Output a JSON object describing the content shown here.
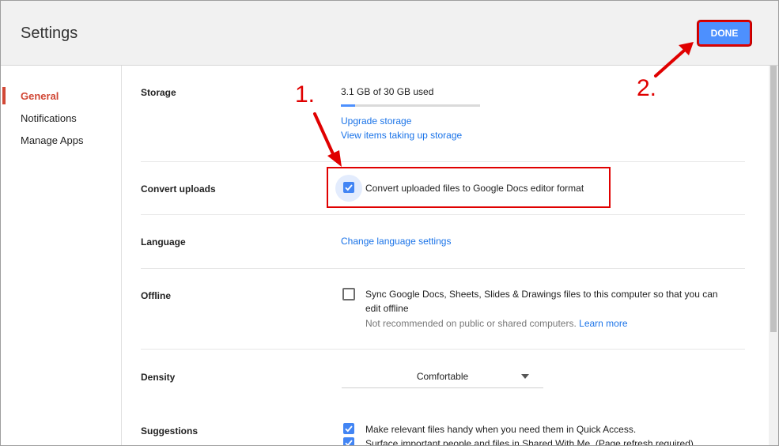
{
  "header": {
    "title": "Settings",
    "done_label": "DONE"
  },
  "sidebar": {
    "items": [
      {
        "label": "General",
        "active": true
      },
      {
        "label": "Notifications",
        "active": false
      },
      {
        "label": "Manage Apps",
        "active": false
      }
    ]
  },
  "storage": {
    "label": "Storage",
    "usage_text": "3.1 GB of 30 GB used",
    "used_fraction": 0.103,
    "upgrade_link": "Upgrade storage",
    "view_items_link": "View items taking up storage"
  },
  "convert_uploads": {
    "label": "Convert uploads",
    "checkbox_text": "Convert uploaded files to Google Docs editor format",
    "checked": true
  },
  "language": {
    "label": "Language",
    "link": "Change language settings"
  },
  "offline": {
    "label": "Offline",
    "checkbox_line1": "Sync Google Docs, Sheets, Slides & Drawings files to this computer so that you can",
    "checkbox_line2": "edit offline",
    "note": "Not recommended on public or shared computers.",
    "learn_more": "Learn more",
    "checked": false
  },
  "density": {
    "label": "Density",
    "selected": "Comfortable"
  },
  "suggestions": {
    "label": "Suggestions",
    "items": [
      {
        "text": "Make relevant files handy when you need them in Quick Access.",
        "checked": true
      },
      {
        "text": "Surface important people and files in Shared With Me. (Page refresh required)",
        "checked": true
      }
    ]
  },
  "annotations": {
    "step1": "1.",
    "step2": "2.",
    "color": "#e00000"
  }
}
